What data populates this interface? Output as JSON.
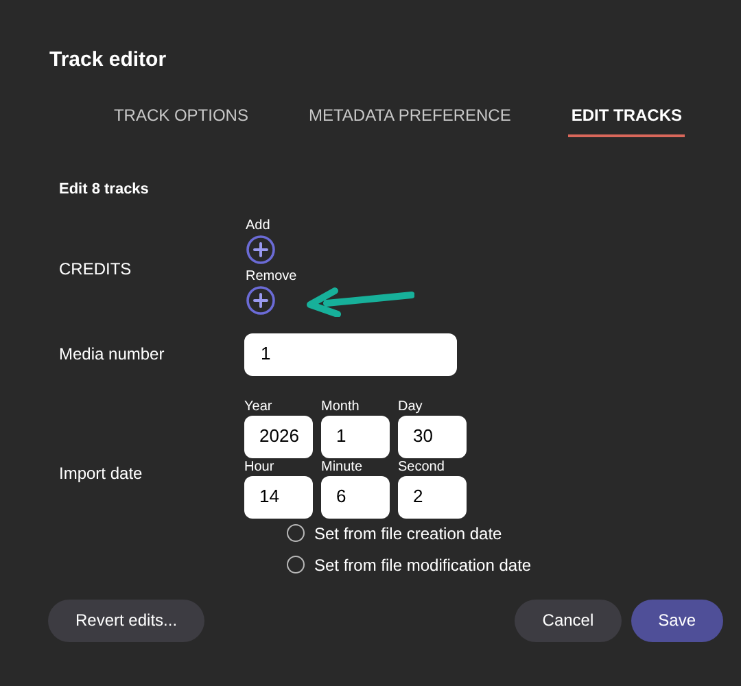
{
  "dialog": {
    "title": "Track editor"
  },
  "tabs": [
    {
      "label": "TRACK OPTIONS",
      "selected": false
    },
    {
      "label": "METADATA PREFERENCE",
      "selected": false
    },
    {
      "label": "EDIT TRACKS",
      "selected": true
    }
  ],
  "section_title": "Edit 8 tracks",
  "credits": {
    "label": "CREDITS",
    "actions": [
      {
        "label": "Add"
      },
      {
        "label": "Remove"
      }
    ]
  },
  "media_number": {
    "label": "Media number",
    "value": "1"
  },
  "import_date": {
    "label": "Import date",
    "date_fields": [
      {
        "label": "Year",
        "value": "2026"
      },
      {
        "label": "Month",
        "value": "1"
      },
      {
        "label": "Day",
        "value": "30"
      }
    ],
    "time_fields": [
      {
        "label": "Hour",
        "value": "14"
      },
      {
        "label": "Minute",
        "value": "6"
      },
      {
        "label": "Second",
        "value": "2"
      }
    ],
    "options": [
      {
        "label": "Set from file creation date",
        "selected": false
      },
      {
        "label": "Set from file modification date",
        "selected": false
      }
    ]
  },
  "buttons": [
    {
      "label": "Revert edits...",
      "kind": "secondary"
    },
    {
      "label": "Cancel",
      "kind": "secondary"
    },
    {
      "label": "Save",
      "kind": "primary"
    }
  ]
}
